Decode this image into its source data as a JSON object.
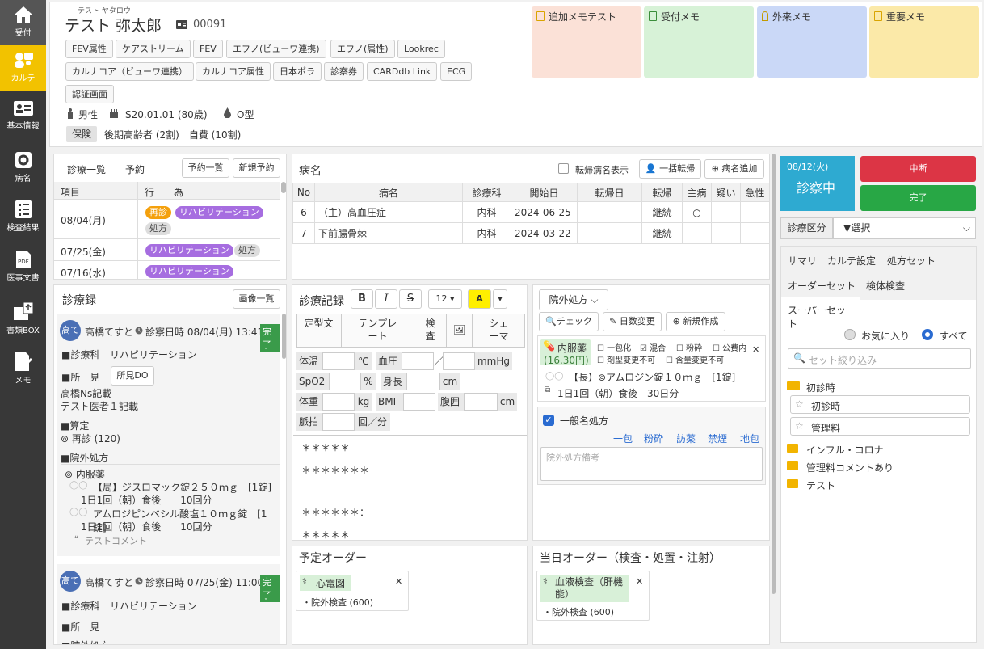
{
  "sidebar": [
    {
      "label": "受付",
      "icon": "home-icon"
    },
    {
      "label": "カルテ",
      "icon": "people-icon"
    },
    {
      "label": "基本情報",
      "icon": "id-card-icon"
    },
    {
      "label": "病名",
      "icon": "gear-icon"
    },
    {
      "label": "検査結果",
      "icon": "checklist-icon"
    },
    {
      "label": "医事文書",
      "icon": "pdf-icon"
    },
    {
      "label": "書類BOX",
      "icon": "upload-box-icon"
    },
    {
      "label": "メモ",
      "icon": "memo-icon"
    }
  ],
  "patient": {
    "kana": "テスト ヤタロウ",
    "name": "テスト 弥太郎",
    "id": "00091",
    "gender": "男性",
    "birth": "S20.01.01 (80歳)",
    "blood": "O型",
    "insurance_label": "保険",
    "insurance_text": "後期高齢者 (2割)　自費 (10割)"
  },
  "tags": [
    "FEV属性",
    "ケアストリーム",
    "FEV",
    "エフノ(ビューワ連携)",
    "エフノ(属性)",
    "Lookrec",
    "カルナコア（ビューワ連携）",
    "カルナコア属性",
    "日本ポラ",
    "診察券",
    "CARDdb Link",
    "ECG",
    "認証画面"
  ],
  "memos": [
    {
      "label": "追加メモテスト",
      "color": "#fbe1d7"
    },
    {
      "label": "受付メモ",
      "color": "#d7f2d7"
    },
    {
      "label": "外来メモ",
      "color": "#cad8f7"
    },
    {
      "label": "重要メモ",
      "color": "#fbe9a8"
    }
  ],
  "visits": {
    "tabs": [
      "診療一覧",
      "予約"
    ],
    "buttons": [
      "予約一覧",
      "新規予約"
    ],
    "headers": [
      "項目",
      "行　　為"
    ],
    "rows": [
      {
        "date": "08/04(月)",
        "tags": [
          "再診",
          "リハビリテーション",
          "処方"
        ]
      },
      {
        "date": "07/25(金)",
        "tags": [
          "リハビリテーション",
          "処方"
        ]
      },
      {
        "date": "07/16(水)",
        "tags": [
          "リハビリテーション"
        ]
      }
    ]
  },
  "record_list": {
    "title": "診療録",
    "image_button": "画像一覧",
    "entries": [
      {
        "avatar": "高て",
        "doctor": "高橋てすと",
        "time_label": "診察日時 08/04(月) 13:41",
        "status": "完了",
        "dept_label": "■診療科",
        "dept": "リハビリテーション",
        "finding_label": "■所　見",
        "finding_btn": "所見DO",
        "notes": [
          "高橋Ns記載",
          "テスト医者１記載"
        ],
        "calc_label": "■算定",
        "calc": "⊚ 再診 (120)",
        "rx_label": "■院外処方",
        "rx_group": "⊚ 内服薬",
        "drugs": [
          {
            "name": "【局】ジスロマック錠２５０ｍｇ　[1錠]",
            "dose": "1日1回（朝）食後　　10回分"
          },
          {
            "name": "アムロジピンベシル酸塩１０ｍｇ錠　[1錠]",
            "dose": "1日1回（朝）食後　　10回分"
          }
        ],
        "comment": "テストコメント"
      },
      {
        "avatar": "高て",
        "doctor": "高橋てすと",
        "time_label": "診察日時 07/25(金) 11:00",
        "status": "完了",
        "dept_label": "■診療科",
        "dept": "リハビリテーション",
        "finding_label": "■所　見",
        "rx_label": "■院外処方"
      }
    ]
  },
  "disease": {
    "title": "病名",
    "checkbox": "転帰病名表示",
    "btn1": "一括転帰",
    "btn2": "病名追加",
    "headers": [
      "No",
      "病名",
      "診療科",
      "開始日",
      "転帰日",
      "転帰",
      "主病",
      "疑い",
      "急性"
    ],
    "rows": [
      [
        "6",
        "（主）高血圧症",
        "内科",
        "2024-06-25",
        "",
        "継続",
        "○",
        "",
        ""
      ],
      [
        "7",
        "下前腸骨棘",
        "内科",
        "2024-03-22",
        "",
        "継続",
        "",
        "",
        ""
      ]
    ]
  },
  "record": {
    "title": "診療記録",
    "font_size": "12",
    "tabs": [
      "定型文",
      "テンプレート",
      "検査",
      "",
      "シェーマ"
    ],
    "vitals": {
      "temp": "体温",
      "temp_unit": "℃",
      "bp": "血圧",
      "bp_sep": "／",
      "bp_unit": "mmHg",
      "spo2": "SpO2",
      "spo2_unit": "%",
      "height": "身長",
      "height_unit": "cm",
      "weight": "体重",
      "weight_unit": "kg",
      "bmi": "BMI",
      "waist": "腹囲",
      "waist_unit": "cm",
      "pulse": "脈拍",
      "pulse_unit": "回／分"
    },
    "lines": [
      "＊＊＊＊＊",
      "＊＊＊＊＊＊＊",
      "",
      "＊＊＊＊＊＊：",
      "＊＊＊＊＊"
    ]
  },
  "rx": {
    "select": "院外処方",
    "btn_check": "チェック",
    "btn_days": "日数変更",
    "btn_new": "新規作成",
    "group_label": "内服薬",
    "group_price": "(16.30円)",
    "options": [
      "一包化",
      "混合",
      "粉砕",
      "公費内",
      "剤型変更不可",
      "含量変更不可"
    ],
    "drug": "【長】⊚アムロジン錠１０ｍｇ　[1錠]",
    "dose": "1日1回（朝）食後",
    "days": "30日分",
    "generic_label": "一般名処方",
    "links": [
      "一包",
      "粉砕",
      "訪薬",
      "禁煙",
      "地包"
    ],
    "remark_placeholder": "院外処方備考"
  },
  "orders": {
    "planned_title": "予定オーダー",
    "planned_item": "心電図",
    "planned_detail": "・院外検査 (600)",
    "today_title": "当日オーダー（検査・処置・注射）",
    "today_item": "血液検査（肝機能）",
    "today_detail": "・院外検査 (600)"
  },
  "status": {
    "date": "08/12(火)",
    "state": "診察中",
    "btn_stop": "中断",
    "btn_done": "完了",
    "category_label": "診療区分",
    "category_value": "▼選択"
  },
  "right": {
    "tabs": [
      "サマリ",
      "カルテ設定",
      "処方セット",
      "オーダーセット",
      "検体検査",
      "スーパーセット"
    ],
    "radio_fav": "お気に入り",
    "radio_all": "すべて",
    "search_placeholder": "セット絞り込み",
    "folder_open": "初診時",
    "items": [
      "初診時",
      "管理料"
    ],
    "folders": [
      "インフル・コロナ",
      "管理料コメントあり",
      "テスト"
    ]
  },
  "colors": {
    "accent": "#f2c200",
    "sidebar": "#383838",
    "status_bg": "#2eaad1",
    "stop": "#dc3545",
    "done": "#28a745",
    "avatar": "#4a6fb5"
  }
}
